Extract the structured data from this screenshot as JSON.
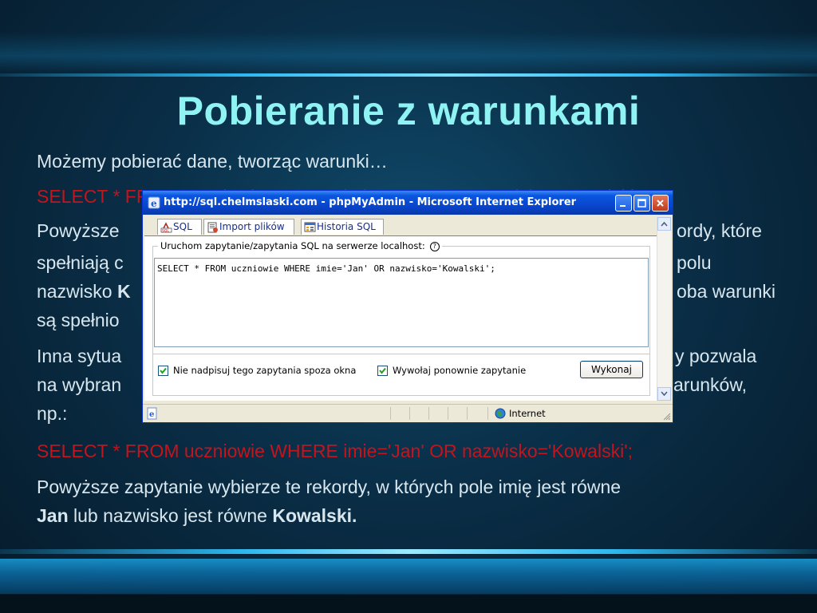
{
  "slide": {
    "title": "Pobieranie z warunkami",
    "p1": "Możemy pobierać dane, tworząc warunki…",
    "p2": "SELECT * FROM uczniowie WHERE imie='Jan' AND nazwisko='Kowalski';",
    "p3": {
      "line1a": "Powyższe",
      "line1b": "ordy, które",
      "line2a": "spełniają c",
      "line2b": "polu",
      "line3a": "nazwisko",
      "line3bold": "K",
      "line3b": "oba warunki",
      "line4a": "są spełnio"
    },
    "p4": {
      "line1a": "Inna sytua",
      "line1b": "y pozwala",
      "line2a": "na wybran",
      "line2b": "arunków,",
      "line3": "np.:"
    },
    "p5": "SELECT * FROM uczniowie WHERE imie='Jan' OR nazwisko='Kowalski';",
    "p6": {
      "text1": "Powyższe zapytanie wybierze te rekordy, w których pole imię jest równe",
      "bold1": "Jan",
      "text2": " lub nazwisko jest równe ",
      "bold2": "Kowalski."
    }
  },
  "window": {
    "title": "http://sql.chelmslaski.com - phpMyAdmin - Microsoft Internet Explorer",
    "tabs": [
      {
        "label": "SQL",
        "icon": "sql-icon"
      },
      {
        "label": "Import plików",
        "icon": "import-icon"
      },
      {
        "label": "Historia SQL",
        "icon": "history-icon"
      }
    ],
    "legend": "Uruchom zapytanie/zapytania SQL na serwerze localhost:",
    "help": "?",
    "query": "SELECT * FROM uczniowie WHERE imie='Jan' OR nazwisko='Kowalski';",
    "opt1": "Nie nadpisuj tego zapytania spoza okna",
    "opt2": "Wywołaj ponownie zapytanie",
    "go": "Wykonaj",
    "status_zone": "Internet",
    "colors": {
      "title_red": "#c4141c",
      "title_cyan": "#8ff3f3",
      "xp_blue": "#0843c8"
    }
  }
}
